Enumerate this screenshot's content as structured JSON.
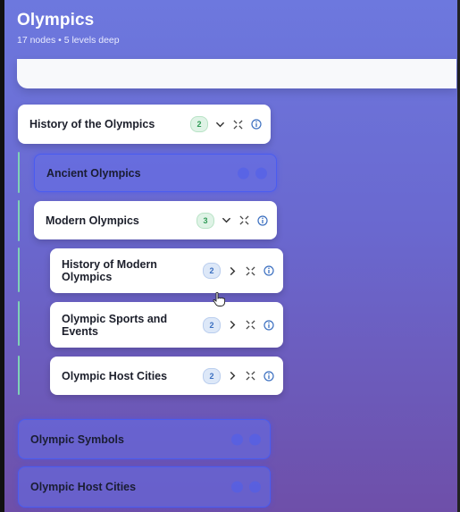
{
  "header": {
    "title": "Olympics",
    "subtitle": "17 nodes • 5 levels deep"
  },
  "colors": {
    "accent": "#4a5cf0",
    "branch": "#7fd1b7",
    "badge_green": "#2f9a55",
    "badge_blue": "#3b6fc0"
  },
  "nodes": [
    {
      "label": "History of the Olympics",
      "count": "2",
      "state": "expanded",
      "level": 1
    },
    {
      "label": "Ancient Olympics",
      "state": "collapsed",
      "level": 2
    },
    {
      "label": "Modern Olympics",
      "count": "3",
      "state": "expanded",
      "level": 2
    },
    {
      "label": "History of Modern Olympics",
      "count": "2",
      "state": "collapsed",
      "level": 3
    },
    {
      "label": "Olympic Sports and Events",
      "count": "2",
      "state": "collapsed",
      "level": 3
    },
    {
      "label": "Olympic Host Cities",
      "count": "2",
      "state": "collapsed",
      "level": 3
    },
    {
      "label": "Olympic Symbols",
      "state": "collapsed",
      "level": 1
    },
    {
      "label": "Olympic Host Cities",
      "state": "collapsed",
      "level": 1
    }
  ],
  "icons": {
    "expand": "chevron-down-icon",
    "collapse": "chevron-right-icon",
    "focus": "focus-icon",
    "info": "info-icon"
  }
}
